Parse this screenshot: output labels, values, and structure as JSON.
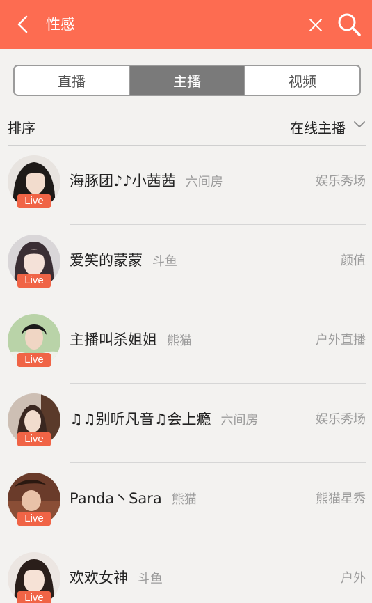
{
  "search": {
    "query": "性感"
  },
  "tabs": [
    {
      "label": "直播",
      "active": false
    },
    {
      "label": "主播",
      "active": true
    },
    {
      "label": "视频",
      "active": false
    }
  ],
  "sort": {
    "label": "排序",
    "filter": "在线主播"
  },
  "colors": {
    "accent": "#fd6c51",
    "live_badge": "#f06446",
    "tab_active": "#7a7a7a"
  },
  "streamers": [
    {
      "name": "海豚团♪♪小茜茜",
      "platform": "六间房",
      "category": "娱乐秀场",
      "badge": "Live"
    },
    {
      "name": "爱笑的蒙蒙",
      "platform": "斗鱼",
      "category": "颜值",
      "badge": "Live"
    },
    {
      "name": "主播叫杀姐姐",
      "platform": "熊猫",
      "category": "户外直播",
      "badge": "Live"
    },
    {
      "name": "♫♫别听凡音♫会上瘾",
      "platform": "六间房",
      "category": "娱乐秀场",
      "badge": "Live"
    },
    {
      "name": "Panda丶Sara",
      "platform": "熊猫",
      "category": "熊猫星秀",
      "badge": "Live"
    },
    {
      "name": "欢欢女神",
      "platform": "斗鱼",
      "category": "户外",
      "badge": "Live"
    }
  ]
}
